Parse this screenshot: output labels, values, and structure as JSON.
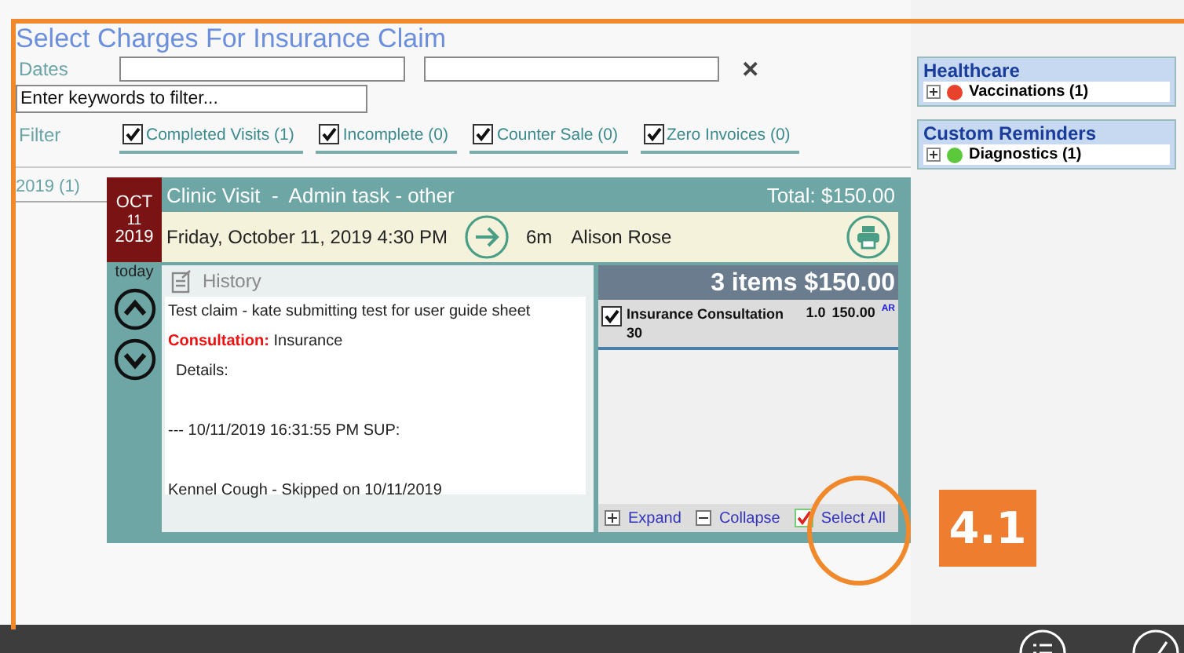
{
  "title": "Select Charges For Insurance Claim",
  "dates": {
    "label": "Dates",
    "clear_icon": "✕"
  },
  "keyword_filter": {
    "value": "Enter keywords to filter..."
  },
  "filter": {
    "label": "Filter",
    "options": [
      {
        "label": "Completed Visits (1)",
        "checked": true
      },
      {
        "label": "Incomplete (0)",
        "checked": true
      },
      {
        "label": "Counter Sale (0)",
        "checked": true
      },
      {
        "label": "Zero Invoices (0)",
        "checked": true
      }
    ]
  },
  "years": [
    {
      "label": "2019 (1)"
    }
  ],
  "visit": {
    "month": "OCT",
    "day": "11",
    "year": "2019",
    "relative": "today",
    "title": "Clinic Visit  -  Admin task - other",
    "total": "Total: $150.00",
    "datetime": "Friday, October 11, 2019 4:30 PM",
    "duration": "6m",
    "provider": "Alison Rose",
    "history": {
      "heading": "History",
      "lines": [
        {
          "kind": "text",
          "text": "Test claim - kate submitting test for user guide sheet"
        },
        {
          "kind": "labeled",
          "label": "Consultation:",
          "text": "Insurance"
        },
        {
          "kind": "indented",
          "text": "Details:"
        },
        {
          "kind": "gap"
        },
        {
          "kind": "text",
          "text": "--- 10/11/2019 16:31:55 PM SUP:"
        },
        {
          "kind": "gap"
        },
        {
          "kind": "text",
          "text": "Kennel Cough - Skipped on 10/11/2019"
        }
      ]
    },
    "items": {
      "summary": "3 items $150.00",
      "rows": [
        {
          "name": "Insurance Consultation 30",
          "qty": "1.0",
          "amount": "150.00",
          "tag": "AR",
          "checked": true
        }
      ]
    },
    "actions": [
      {
        "kind": "expand",
        "label": "Expand"
      },
      {
        "kind": "collapse",
        "label": "Collapse"
      },
      {
        "kind": "select_all",
        "label": "Select All"
      }
    ]
  },
  "sidebar": [
    {
      "title": "Healthcare",
      "items": [
        {
          "label": "Vaccinations (1)",
          "color": "#e8412c"
        }
      ]
    },
    {
      "title": "Custom Reminders",
      "items": [
        {
          "label": "Diagnostics (1)",
          "color": "#5cc83c"
        }
      ]
    }
  ],
  "annotation": {
    "callout": "4.1"
  }
}
